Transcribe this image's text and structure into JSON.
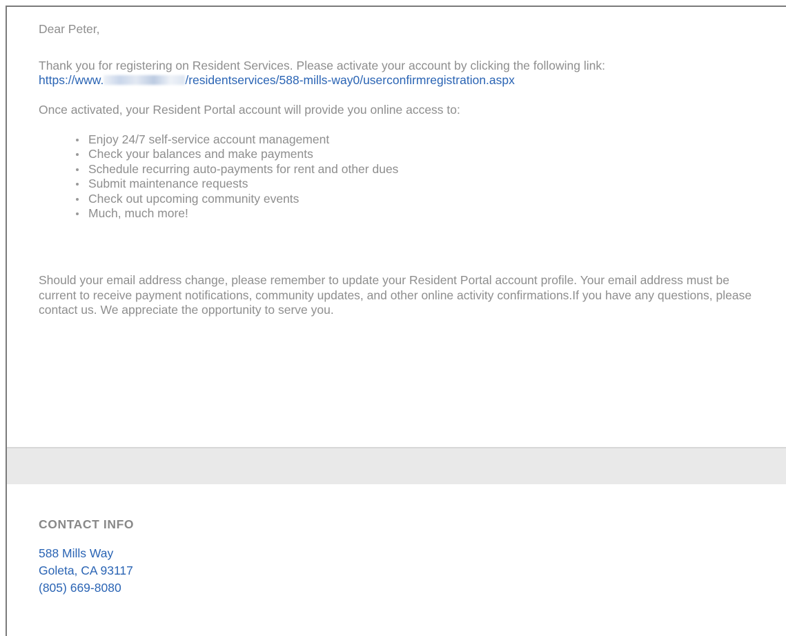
{
  "email": {
    "greeting": "Dear Peter,",
    "intro": "Thank you for registering on Resident Services. Please activate your account by clicking the following link:",
    "activation_link": {
      "prefix": "https://www.",
      "suffix": "/residentservices/588-mills-way0/userconfirmregistration.aspx"
    },
    "features_intro": "Once activated, your Resident Portal account will provide you online access to:",
    "features": [
      "Enjoy 24/7 self-service account management",
      "Check your balances and make payments",
      "Schedule recurring auto-payments for rent and other dues",
      "Submit maintenance requests",
      "Check out upcoming community events",
      "Much, much more!"
    ],
    "closing": "Should your email address change, please remember to update your Resident Portal account profile. Your email address must be current to receive payment notifications, community updates, and other online activity confirmations.If you have any questions, please contact us. We appreciate the opportunity to serve you."
  },
  "contact": {
    "heading": "CONTACT INFO",
    "address_line1": "588 Mills Way",
    "address_line2": "Goleta, CA 93117",
    "phone": "(805) 669-8080"
  },
  "colors": {
    "body_text": "#8e8e8e",
    "link": "#2a64b4",
    "band": "#e9e9e9"
  }
}
